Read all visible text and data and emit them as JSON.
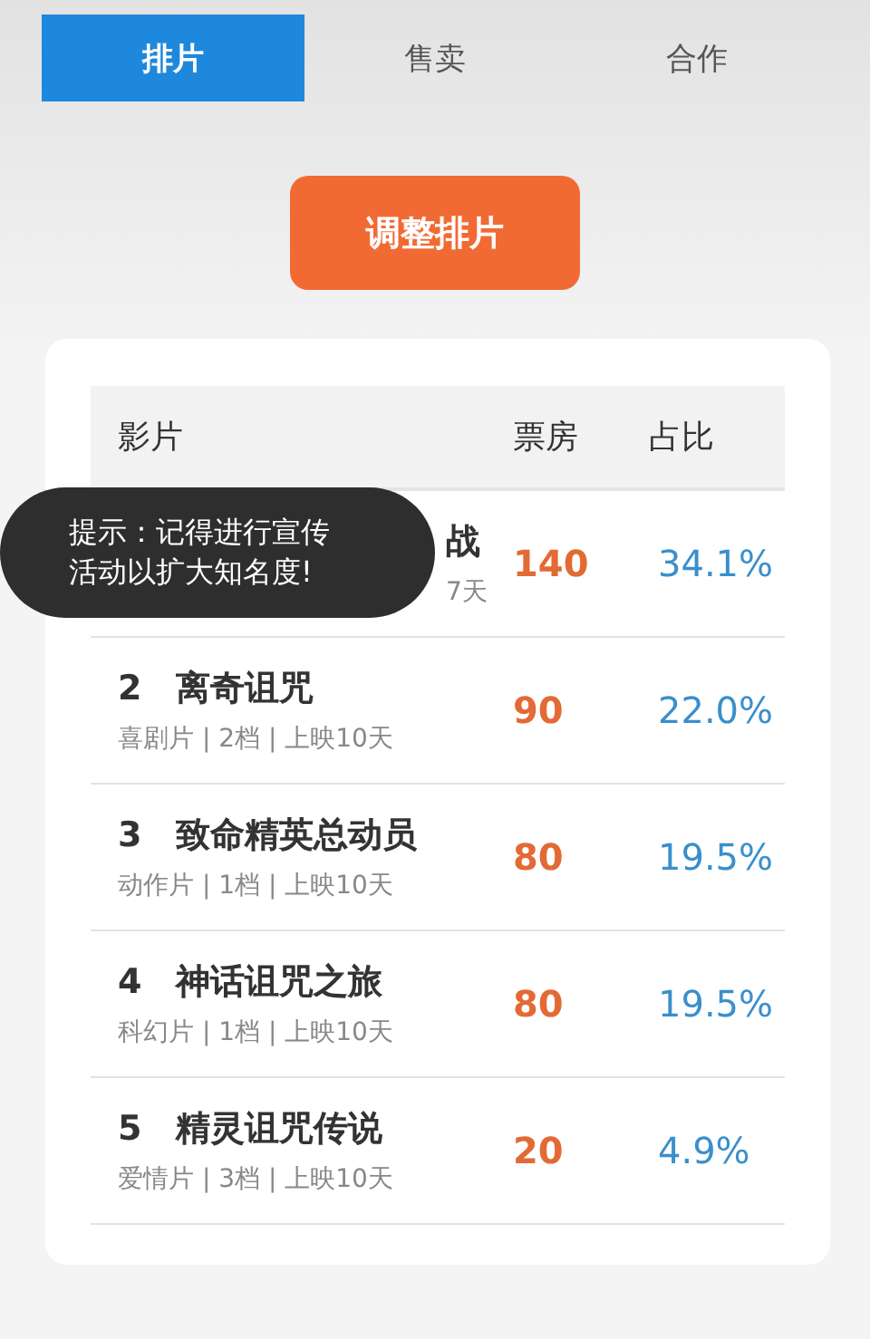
{
  "tabs": [
    {
      "label": "排片",
      "selected": true
    },
    {
      "label": "售卖",
      "selected": false
    },
    {
      "label": "合作",
      "selected": false
    }
  ],
  "adjust_button": "调整排片",
  "table": {
    "columns": [
      "影片",
      "票房",
      "占比"
    ],
    "rows": [
      {
        "title": "战",
        "meta": "7天",
        "box_office": "140",
        "share": "34.1%"
      },
      {
        "rank": "2",
        "title": "离奇诅咒",
        "meta": "喜剧片 | 2档 | 上映10天",
        "box_office": "90",
        "share": "22.0%"
      },
      {
        "rank": "3",
        "title": "致命精英总动员",
        "meta": "动作片 | 1档 | 上映10天",
        "box_office": "80",
        "share": "19.5%"
      },
      {
        "rank": "4",
        "title": "神话诅咒之旅",
        "meta": "科幻片 | 1档 | 上映10天",
        "box_office": "80",
        "share": "19.5%"
      },
      {
        "rank": "5",
        "title": "精灵诅咒传说",
        "meta": "爱情片 | 3档 | 上映10天",
        "box_office": "20",
        "share": "4.9%"
      }
    ]
  },
  "toast": [
    "提示：记得进行宣传",
    "活动以扩大知名度!"
  ]
}
